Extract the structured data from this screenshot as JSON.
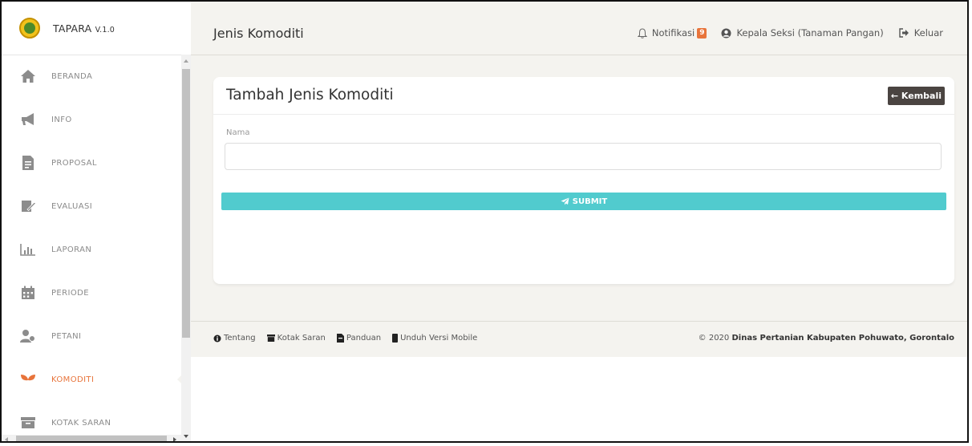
{
  "brand": {
    "name": "TAPARA",
    "version": "V.1.0"
  },
  "sidebar": {
    "items": [
      {
        "label": "BERANDA",
        "icon": "home-icon"
      },
      {
        "label": "INFO",
        "icon": "megaphone-icon"
      },
      {
        "label": "PROPOSAL",
        "icon": "document-icon"
      },
      {
        "label": "EVALUASI",
        "icon": "signature-icon"
      },
      {
        "label": "LAPORAN",
        "icon": "bar-chart-icon"
      },
      {
        "label": "PERIODE",
        "icon": "calendar-icon"
      },
      {
        "label": "PETANI",
        "icon": "users-icon"
      },
      {
        "label": "KOMODITI",
        "icon": "sprout-icon",
        "active": true
      },
      {
        "label": "KOTAK SARAN",
        "icon": "inbox-icon"
      }
    ],
    "active_color": "#e8743b"
  },
  "topbar": {
    "title": "Jenis Komoditi",
    "notifications_label": "Notifikasi",
    "notifications_count": "9",
    "user_label": "Kepala Seksi (Tanaman Pangan)",
    "logout_label": "Keluar"
  },
  "card": {
    "title": "Tambah Jenis Komoditi",
    "back_label": "← Kembali",
    "field_label": "Nama",
    "field_value": "",
    "submit_label": "SUBMIT"
  },
  "footer": {
    "links": [
      "Tentang",
      "Kotak Saran",
      "Panduan",
      "Unduh Versi Mobile"
    ],
    "copyright_prefix": "© 2020 ",
    "copyright_org": "Dinas Pertanian Kabupaten Pohuwato, Gorontalo"
  },
  "colors": {
    "accent": "#51cbce",
    "badge": "#e8743b",
    "dark_button": "#4a4441"
  }
}
